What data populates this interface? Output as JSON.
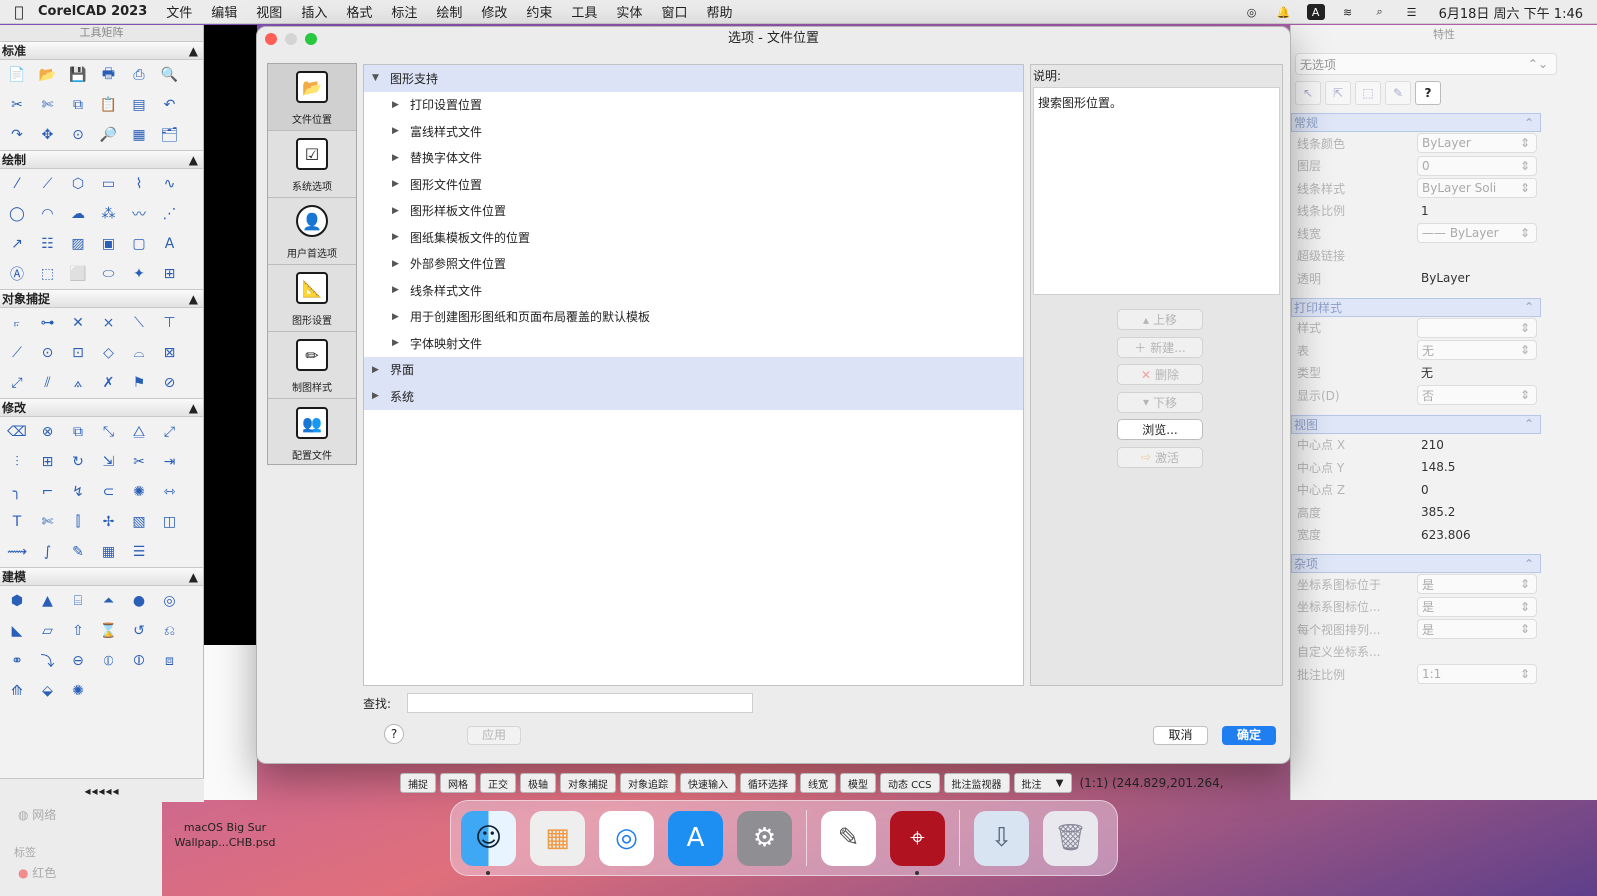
{
  "menubar": {
    "app_name": "CorelCAD 2023",
    "items": [
      "文件",
      "编辑",
      "视图",
      "插入",
      "格式",
      "标注",
      "绘制",
      "修改",
      "约束",
      "工具",
      "实体",
      "窗口",
      "帮助"
    ],
    "clock": "6月18日 周六 下午 1:46"
  },
  "palette": {
    "title": "工具矩阵",
    "sections": [
      "标准",
      "绘制",
      "对象捕捉",
      "修改",
      "建模"
    ],
    "footer": "◂◂◂◂◂"
  },
  "properties": {
    "title": "特性",
    "selector": "无选项",
    "groups": {
      "general": {
        "title": "常规",
        "rows": [
          {
            "label": "线条颜色",
            "value": "ByLayer"
          },
          {
            "label": "图层",
            "value": "0"
          },
          {
            "label": "线条样式",
            "value": "ByLayer    Soli"
          },
          {
            "label": "线条比例",
            "value": "1"
          },
          {
            "label": "线宽",
            "value": "—— ByLayer"
          },
          {
            "label": "超级链接",
            "value": ""
          },
          {
            "label": "透明",
            "value": "ByLayer"
          }
        ]
      },
      "print": {
        "title": "打印样式",
        "rows": [
          {
            "label": "样式",
            "value": ""
          },
          {
            "label": "表",
            "value": "无"
          },
          {
            "label": "类型",
            "value": "无"
          },
          {
            "label": "显示(D)",
            "value": "否"
          }
        ]
      },
      "view": {
        "title": "视图",
        "rows": [
          {
            "label": "中心点 X",
            "value": "210"
          },
          {
            "label": "中心点 Y",
            "value": "148.5"
          },
          {
            "label": "中心点 Z",
            "value": "0"
          },
          {
            "label": "高度",
            "value": "385.2"
          },
          {
            "label": "宽度",
            "value": "623.806"
          }
        ]
      },
      "misc": {
        "title": "杂项",
        "rows": [
          {
            "label": "坐标系图标位于",
            "value": "是"
          },
          {
            "label": "坐标系图标位...",
            "value": "是"
          },
          {
            "label": "每个视图排列...",
            "value": "是"
          },
          {
            "label": "自定义坐标系...",
            "value": ""
          },
          {
            "label": "批注比例",
            "value": "1:1"
          }
        ]
      }
    }
  },
  "dialog": {
    "title": "选项 - 文件位置",
    "categories": [
      {
        "label": "文件位置",
        "icon": "folder-icon"
      },
      {
        "label": "系统选项",
        "icon": "checklist-icon"
      },
      {
        "label": "用户首选项",
        "icon": "user-icon"
      },
      {
        "label": "图形设置",
        "icon": "drawing-settings-icon"
      },
      {
        "label": "制图样式",
        "icon": "drafting-style-icon"
      },
      {
        "label": "配置文件",
        "icon": "profile-icon"
      }
    ],
    "tree": {
      "root": "图形支持",
      "children": [
        "打印设置位置",
        "富线样式文件",
        "替换字体文件",
        "图形文件位置",
        "图形样板文件位置",
        "图纸集模板文件的位置",
        "外部参照文件位置",
        "线条样式文件",
        "用于创建图形图纸和页面布局覆盖的默认模板",
        "字体映射文件"
      ],
      "others": [
        "界面",
        "系统"
      ]
    },
    "description": {
      "heading": "说明:",
      "text": "搜索图形位置。"
    },
    "side_buttons": {
      "up": "上移",
      "new": "新建...",
      "delete": "删除",
      "down": "下移",
      "browse": "浏览...",
      "activate": "激活"
    },
    "search_label": "查找:",
    "search_value": "",
    "help": "?",
    "apply": "应用",
    "cancel": "取消",
    "ok": "确定"
  },
  "statusbar": {
    "buttons": [
      "捕捉",
      "网格",
      "正交",
      "极轴",
      "对象捕捉",
      "对象追踪",
      "快速输入",
      "循环选择",
      "线宽",
      "模型",
      "动态 CCS",
      "批注监视器"
    ],
    "annotation": "批注",
    "coords": "(1:1)  (244.829,201.264,"
  },
  "finder": {
    "sidebar_item": "网络",
    "tags_label": "标签",
    "tag_red": "红色",
    "file_line1": "macOS Big Sur",
    "file_line2": "Wallpap...CHB.psd"
  },
  "dock": {
    "apps": [
      "finder-icon",
      "launchpad-icon",
      "safari-icon",
      "app-store-icon",
      "system-preferences-icon",
      "textedit-icon",
      "corelcad-icon",
      "downloads-icon",
      "trash-icon"
    ]
  }
}
